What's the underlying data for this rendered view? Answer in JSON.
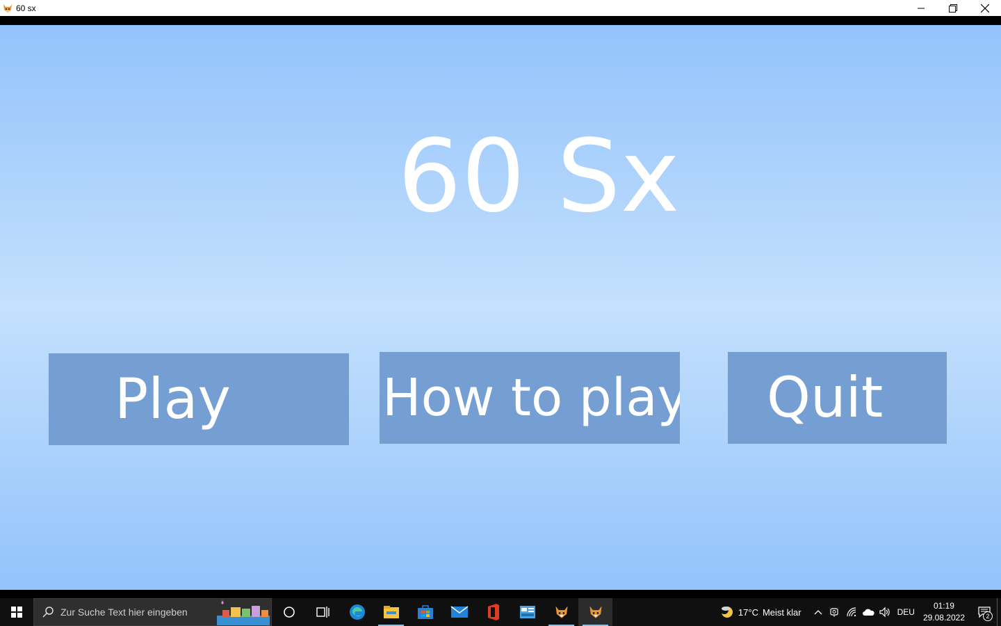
{
  "window": {
    "title": "60 sx",
    "icon": "fox-app-icon",
    "controls": [
      "minimize-icon",
      "restore-icon",
      "close-icon"
    ]
  },
  "game": {
    "title": "60 Sx",
    "buttons": {
      "play": "Play",
      "how_to_play": "How to play",
      "quit": "Quit"
    },
    "colors": {
      "background_edge": "#93c3fb",
      "background_center": "#c4e0fd",
      "button": "#759fd2",
      "text": "#ffffff"
    }
  },
  "taskbar": {
    "search_placeholder": "Zur Suche Text hier eingeben",
    "pinned": [
      "cortana-icon",
      "task-view-icon",
      "edge-icon",
      "file-explorer-icon",
      "store-icon",
      "mail-icon",
      "office-icon",
      "control-panel-icon",
      "fox-app-icon",
      "fox-app-icon"
    ],
    "weather": {
      "temp": "17°C",
      "condition": "Meist klar"
    },
    "language": "DEU",
    "time": "01:19",
    "date": "29.08.2022",
    "notifications": "2"
  }
}
